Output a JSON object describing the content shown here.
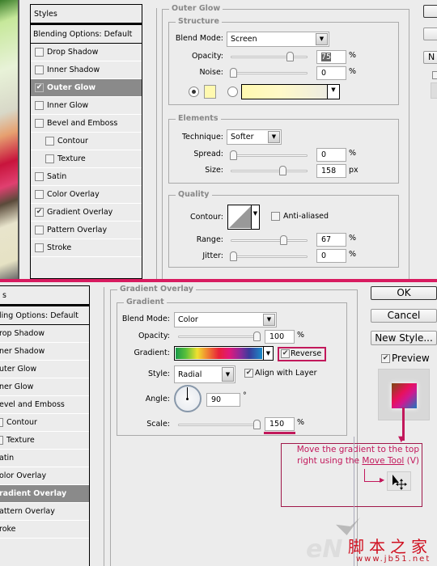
{
  "top_dialog": {
    "styles_panel": {
      "title": "Styles",
      "blending": "Blending Options: Default",
      "items": [
        {
          "label": "Drop Shadow",
          "checked": false,
          "selected": false,
          "sub": false
        },
        {
          "label": "Inner Shadow",
          "checked": false,
          "selected": false,
          "sub": false
        },
        {
          "label": "Outer Glow",
          "checked": true,
          "selected": true,
          "sub": false
        },
        {
          "label": "Inner Glow",
          "checked": false,
          "selected": false,
          "sub": false
        },
        {
          "label": "Bevel and Emboss",
          "checked": false,
          "selected": false,
          "sub": false
        },
        {
          "label": "Contour",
          "checked": false,
          "selected": false,
          "sub": true
        },
        {
          "label": "Texture",
          "checked": false,
          "selected": false,
          "sub": true
        },
        {
          "label": "Satin",
          "checked": false,
          "selected": false,
          "sub": false
        },
        {
          "label": "Color Overlay",
          "checked": false,
          "selected": false,
          "sub": false
        },
        {
          "label": "Gradient Overlay",
          "checked": true,
          "selected": false,
          "sub": false
        },
        {
          "label": "Pattern Overlay",
          "checked": false,
          "selected": false,
          "sub": false
        },
        {
          "label": "Stroke",
          "checked": false,
          "selected": false,
          "sub": false
        }
      ]
    },
    "outer_glow": {
      "title": "Outer Glow",
      "structure": {
        "title": "Structure",
        "blend_mode_label": "Blend Mode:",
        "blend_mode": "Screen",
        "opacity_label": "Opacity:",
        "opacity": "75",
        "opacity_unit": "%",
        "noise_label": "Noise:",
        "noise": "0",
        "noise_unit": "%",
        "glow_color": "#fff9b0"
      },
      "elements": {
        "title": "Elements",
        "technique_label": "Technique:",
        "technique": "Softer",
        "spread_label": "Spread:",
        "spread": "0",
        "spread_unit": "%",
        "size_label": "Size:",
        "size": "158",
        "size_unit": "px"
      },
      "quality": {
        "title": "Quality",
        "contour_label": "Contour:",
        "anti_aliased_label": "Anti-aliased",
        "anti_aliased": false,
        "range_label": "Range:",
        "range": "67",
        "range_unit": "%",
        "jitter_label": "Jitter:",
        "jitter": "0",
        "jitter_unit": "%"
      }
    },
    "side_buttons": {
      "new_partial": "N"
    }
  },
  "bottom_dialog": {
    "styles_panel": {
      "title": "s",
      "blending": "ling Options: Default",
      "items": [
        {
          "label": "rop Shadow",
          "selected": false
        },
        {
          "label": "ner Shadow",
          "selected": false
        },
        {
          "label": "uter Glow",
          "selected": false
        },
        {
          "label": "ner Glow",
          "selected": false
        },
        {
          "label": "evel and Emboss",
          "selected": false
        },
        {
          "label": "Contour",
          "selected": false,
          "sub": true
        },
        {
          "label": "Texture",
          "selected": false,
          "sub": true
        },
        {
          "label": "atin",
          "selected": false
        },
        {
          "label": "olor Overlay",
          "selected": false
        },
        {
          "label": "radient Overlay",
          "selected": true
        },
        {
          "label": "attern Overlay",
          "selected": false
        },
        {
          "label": "roke",
          "selected": false
        }
      ]
    },
    "gradient_overlay": {
      "title": "Gradient Overlay",
      "gradient_group": "Gradient",
      "blend_mode_label": "Blend Mode:",
      "blend_mode": "Color",
      "opacity_label": "Opacity:",
      "opacity": "100",
      "opacity_unit": "%",
      "gradient_label": "Gradient:",
      "reverse_label": "Reverse",
      "reverse": true,
      "style_label": "Style:",
      "style": "Radial",
      "align_label": "Align with Layer",
      "align": true,
      "angle_label": "Angle:",
      "angle": "90",
      "angle_unit": "°",
      "scale_label": "Scale:",
      "scale": "150",
      "scale_unit": "%"
    },
    "buttons": {
      "ok": "OK",
      "cancel": "Cancel",
      "new_style": "New Style...",
      "preview_label": "Preview",
      "preview": true
    },
    "annotation": {
      "line1": "Move the gradient to the top",
      "line2_prefix": "right using the ",
      "line2_link": "Move Tool",
      "line2_suffix": " (V)"
    }
  },
  "watermark": {
    "logo": "eN",
    "cn_title": "脚本之家",
    "url": "www.jb51.net"
  },
  "colors": {
    "accent": "#d81b60",
    "selected_row": "#8a8a8a"
  }
}
